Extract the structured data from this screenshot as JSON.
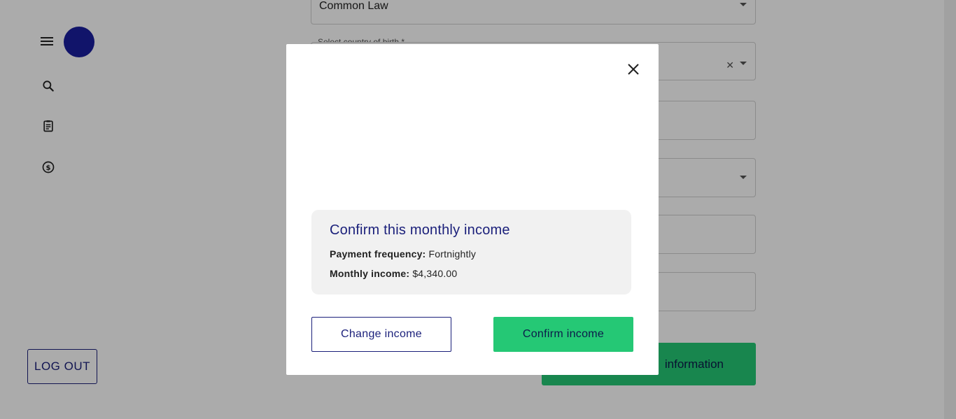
{
  "background": {
    "marital_status_value": "Common Law",
    "country_of_birth_label": "Select country of birth *",
    "submit_button_partial": "information",
    "logout_label": "LOG OUT"
  },
  "nav": {
    "icons": [
      "menu-icon",
      "search-icon",
      "clipboard-icon",
      "dollar-circle-icon"
    ]
  },
  "modal": {
    "title": "Confirm this monthly income",
    "payment_frequency_label": "Payment frequency:",
    "payment_frequency_value": "Fortnightly",
    "monthly_income_label": "Monthly income:",
    "monthly_income_value": "$4,340.00",
    "change_button": "Change income",
    "confirm_button": "Confirm income"
  },
  "colors": {
    "brand_navy": "#1a1f7a",
    "accent_green": "#25c875",
    "avatar": "#1a1f9e"
  }
}
